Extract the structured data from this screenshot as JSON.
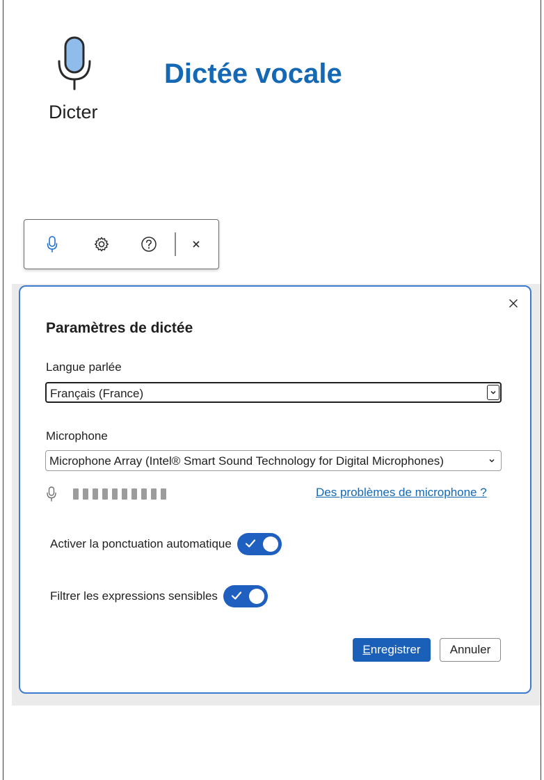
{
  "header": {
    "title": "Dictée vocale",
    "dictate_button_label": "Dicter"
  },
  "toolbar": {
    "items": [
      {
        "icon": "microphone-icon",
        "color": "#1f6fd0"
      },
      {
        "icon": "gear-icon"
      },
      {
        "icon": "help-icon"
      },
      {
        "icon": "close-icon"
      }
    ]
  },
  "dialog": {
    "title": "Paramètres de dictée",
    "language": {
      "label": "Langue parlée",
      "value": "Français (France)"
    },
    "microphone": {
      "label": "Microphone",
      "value": "Microphone Array (Intel® Smart Sound Technology for Digital Microphones)",
      "level_segments": 10,
      "level_active": 0,
      "help_link": "Des problèmes de microphone ?"
    },
    "toggles": [
      {
        "label": "Activer la ponctuation automatique",
        "on": true
      },
      {
        "label": "Filtrer les expressions sensibles",
        "on": true
      }
    ],
    "buttons": {
      "save_mnemonic": "E",
      "save_rest": "nregistrer",
      "cancel": "Annuler"
    }
  },
  "colors": {
    "title": "#1468b4",
    "accent": "#1f5fbf",
    "dialog_border": "#3a7bd0",
    "mic_fill": "#8fbcea"
  }
}
